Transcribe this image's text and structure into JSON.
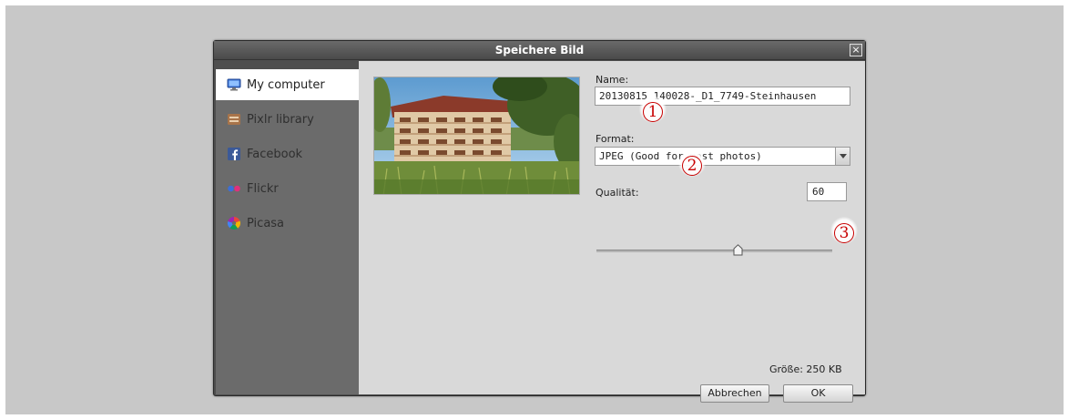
{
  "dialog": {
    "title": "Speichere Bild",
    "close_label": "×"
  },
  "sidebar": {
    "items": [
      {
        "label": "My computer",
        "icon": "monitor-icon",
        "active": true
      },
      {
        "label": "Pixlr library",
        "icon": "library-icon",
        "active": false
      },
      {
        "label": "Facebook",
        "icon": "facebook-icon",
        "active": false
      },
      {
        "label": "Flickr",
        "icon": "flickr-icon",
        "active": false
      },
      {
        "label": "Picasa",
        "icon": "picasa-icon",
        "active": false
      }
    ]
  },
  "form": {
    "name_label": "Name:",
    "name_value": "20130815_140028-_D1_7749-Steinhausen",
    "format_label": "Format:",
    "format_value": "JPEG (Good for most photos)",
    "quality_label": "Qualität:",
    "quality_value": "60",
    "quality_level_percent": 60,
    "size_text": "Größe: 250 KB"
  },
  "buttons": {
    "cancel": "Abbrechen",
    "ok": "OK"
  },
  "markers": [
    "1",
    "2",
    "3"
  ],
  "colors": {
    "marker": "#c80000",
    "dialog_bg": "#4e4e4e",
    "sidebar_bg": "#6b6b6b",
    "content_bg": "#d9d9d9"
  }
}
